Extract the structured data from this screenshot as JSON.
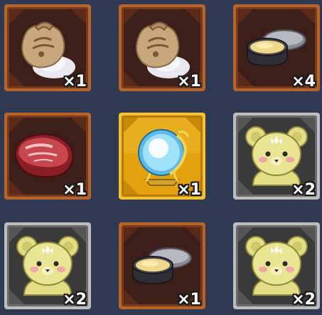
{
  "inventory": {
    "items": [
      {
        "icon": "flour-sack-icon",
        "rarity": "bronze",
        "quantity": "×1"
      },
      {
        "icon": "flour-sack-icon",
        "rarity": "bronze",
        "quantity": "×1"
      },
      {
        "icon": "butter-tin-icon",
        "rarity": "bronze",
        "quantity": "×4"
      },
      {
        "icon": "raw-meat-icon",
        "rarity": "bronze",
        "quantity": "×1"
      },
      {
        "icon": "crystal-orb-icon",
        "rarity": "gold",
        "quantity": "×1"
      },
      {
        "icon": "bear-plush-icon",
        "rarity": "silver",
        "quantity": "×2"
      },
      {
        "icon": "bear-plush-icon",
        "rarity": "silver",
        "quantity": "×2"
      },
      {
        "icon": "butter-tin-icon",
        "rarity": "bronze",
        "quantity": "×1"
      },
      {
        "icon": "bear-plush-icon",
        "rarity": "silver",
        "quantity": "×2"
      }
    ]
  },
  "colors": {
    "background": "#2f3a52",
    "bronze_frame": "#b5652b",
    "bronze_fill": "#3d1f1a",
    "silver_frame": "#bdbdbd",
    "silver_fill": "#3a3a3a",
    "gold_frame": "#f2c232",
    "gold_fill": "#e2a10d"
  }
}
